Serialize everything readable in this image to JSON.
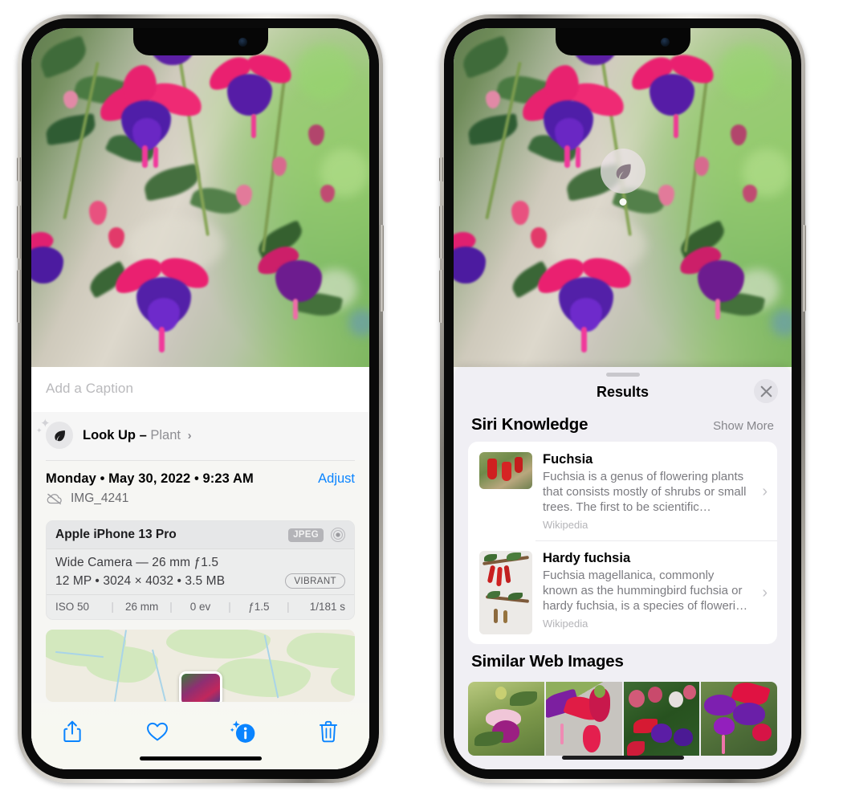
{
  "left_phone": {
    "name": "iPhone showing Photos info panel",
    "photo": {
      "alt": "Fuchsia flowers hanging basket",
      "filename": "IMG_4241"
    },
    "caption_field": {
      "placeholder": "Add a Caption",
      "value": ""
    },
    "look_up": {
      "icon": "leaf-icon",
      "label": "Look Up",
      "separator": "–",
      "subject": "Plant",
      "chevron": "›"
    },
    "meta": {
      "date": "Monday • May 30, 2022 • 9:23 AM",
      "adjust_label": "Adjust",
      "cloud_icon": "icloud-slash-icon",
      "filename": "IMG_4241"
    },
    "exif": {
      "device": "Apple iPhone 13 Pro",
      "format_badge": "JPEG",
      "lens_icon": "lens-icon",
      "lens_line": "Wide Camera — 26 mm ƒ1.5",
      "size_line": "12 MP • 3024 × 4032 • 3.5 MB",
      "profile_badge": "VIBRANT",
      "stats": [
        "ISO 50",
        "26 mm",
        "0 ev",
        "ƒ1.5",
        "1/181 s"
      ],
      "separator": "|"
    },
    "map": {
      "alt": "Map of photo location with photo pin"
    },
    "toolbar": [
      {
        "name": "share-icon",
        "label": "Share"
      },
      {
        "name": "heart-icon",
        "label": "Favorite"
      },
      {
        "name": "info-sparkle-icon",
        "label": "Info"
      },
      {
        "name": "trash-icon",
        "label": "Delete"
      }
    ],
    "accent_color": "#0a84ff"
  },
  "right_phone": {
    "name": "iPhone showing Visual Look Up results",
    "photo_badge": {
      "icon": "leaf-icon",
      "label": "Plant look up"
    },
    "sheet": {
      "grabber": "drag-handle",
      "title": "Results",
      "close_icon": "close-icon"
    },
    "siri_knowledge": {
      "heading": "Siri Knowledge",
      "show_more": "Show More",
      "items": [
        {
          "title": "Fuchsia",
          "description": "Fuchsia is a genus of flowering plants that consists mostly of shrubs or small trees. The first to be scientific…",
          "source": "Wikipedia",
          "thumb_alt": "Red fuchsia flowers on a bush",
          "chevron": "›"
        },
        {
          "title": "Hardy fuchsia",
          "description": "Fuchsia magellanica, commonly known as the hummingbird fuchsia or hardy fuchsia, is a species of floweri…",
          "source": "Wikipedia",
          "thumb_alt": "Hardy fuchsia branch with red flowers",
          "chevron": "›"
        }
      ]
    },
    "similar_web_images": {
      "heading": "Similar Web Images",
      "items": [
        {
          "alt": "Pink and magenta fuchsia with leaves"
        },
        {
          "alt": "Close-up red fuchsia bloom"
        },
        {
          "alt": "Fuchsia bush with many buds"
        },
        {
          "alt": "Purple and red fuchsia cluster"
        }
      ]
    }
  },
  "colors": {
    "ios_blue": "#0a84ff",
    "sheet_bg": "#f0eff4",
    "card_bg": "#ffffff",
    "secondary_text": "#8e8e93",
    "tertiary_text": "#b4b4b8",
    "exif_bg": "#eceded"
  }
}
